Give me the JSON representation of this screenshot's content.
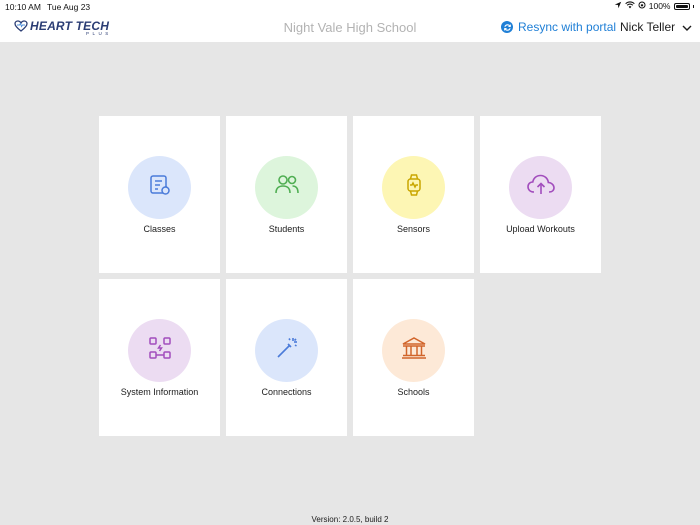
{
  "status_bar": {
    "time": "10:10 AM",
    "date": "Tue Aug 23",
    "battery": "100%"
  },
  "header": {
    "logo_main": "HEART TECH",
    "logo_sub": "PLUS",
    "school_name": "Night Vale High School",
    "resync_label": "Resync with portal",
    "user_name": "Nick Teller"
  },
  "tiles": [
    {
      "label": "Classes",
      "icon": "classes-icon",
      "color": "#dbe6fb",
      "icon_color": "#4b7bd9"
    },
    {
      "label": "Students",
      "icon": "students-icon",
      "color": "#ddf5dc",
      "icon_color": "#4fae52"
    },
    {
      "label": "Sensors",
      "icon": "sensor-watch-icon",
      "color": "#fdf6b4",
      "icon_color": "#c9a600"
    },
    {
      "label": "Upload Workouts",
      "icon": "cloud-upload-icon",
      "color": "#ecdcf2",
      "icon_color": "#a24dbd"
    },
    {
      "label": "System Information",
      "icon": "system-info-icon",
      "color": "#ecdcf2",
      "icon_color": "#a24dbd"
    },
    {
      "label": "Connections",
      "icon": "magic-wand-icon",
      "color": "#dbe6fb",
      "icon_color": "#4b7bd9"
    },
    {
      "label": "Schools",
      "icon": "school-building-icon",
      "color": "#fde9d7",
      "icon_color": "#d1642a"
    }
  ],
  "footer": {
    "version": "Version: 2.0.5, build 2"
  }
}
